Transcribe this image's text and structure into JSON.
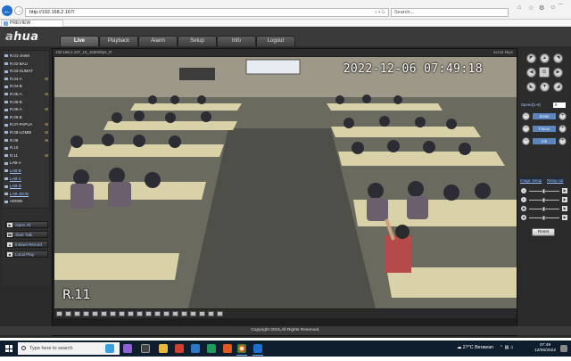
{
  "browser": {
    "url": "http://192.168.2.167/",
    "search_placeholder": "Search...",
    "tab_title": "PREVIEW"
  },
  "app": {
    "logo_prefix": "a",
    "logo_rest": "hua",
    "nav_tabs": [
      "Live",
      "Playback",
      "Alarm",
      "Setup",
      "Info",
      "Logout"
    ],
    "active_tab": "Live",
    "channels": [
      {
        "label": "R.01-JAWA",
        "flag": ""
      },
      {
        "label": "R.02-BALI",
        "flag": ""
      },
      {
        "label": "R.03-SUMAT",
        "flag": ""
      },
      {
        "label": "R.04-A",
        "flag": "M"
      },
      {
        "label": "R.04-B",
        "flag": ""
      },
      {
        "label": "R.05-A",
        "flag": "M"
      },
      {
        "label": "R.05-B",
        "flag": ""
      },
      {
        "label": "R.06-A",
        "flag": "M"
      },
      {
        "label": "R.06-B",
        "flag": ""
      },
      {
        "label": "R.07-PAPUA",
        "flag": "M"
      },
      {
        "label": "R.08-LOMBI",
        "flag": "M"
      },
      {
        "label": "R.09",
        "flag": "M"
      },
      {
        "label": "R.10",
        "flag": ""
      },
      {
        "label": "R.11",
        "flag": "M"
      },
      {
        "label": "LAB-A",
        "flag": ""
      },
      {
        "label": "LAB-B",
        "flag": ""
      },
      {
        "label": "LAB-C",
        "flag": ""
      },
      {
        "label": "LAB-D",
        "flag": ""
      },
      {
        "label": "LAB-JIGIN",
        "flag": ""
      },
      {
        "label": "ADMIN",
        "flag": ""
      }
    ],
    "actions": [
      "Open All",
      "Start Talk",
      "Instant Record",
      "Local Play"
    ],
    "video_title": "192.168.2.167_16_1650Kbps_R",
    "video_stats": "4x1x5 kbps",
    "osd_time": "2022-12-06  07:49:18",
    "osd_name": "R.11",
    "ptz_speed_label": "Speed(1-8)",
    "ptz_speed_value": "5",
    "ptz_adjust": [
      "Zoom",
      "Focus",
      "Iris"
    ],
    "setup_tabs": [
      "Image Setup",
      "Relay-out"
    ],
    "reset_label": "Reset",
    "copyright": "Copyright 2015,All Rights Reserved."
  },
  "taskbar": {
    "search_placeholder": "Type here to search",
    "weather": "27°C  Berawan",
    "time": "07:49",
    "date": "12/06/2022"
  },
  "colors": {
    "accent_link": "#9ec3ff",
    "app_bg": "#2a2a2a",
    "taskbar_bg": "#0f1e2e"
  }
}
